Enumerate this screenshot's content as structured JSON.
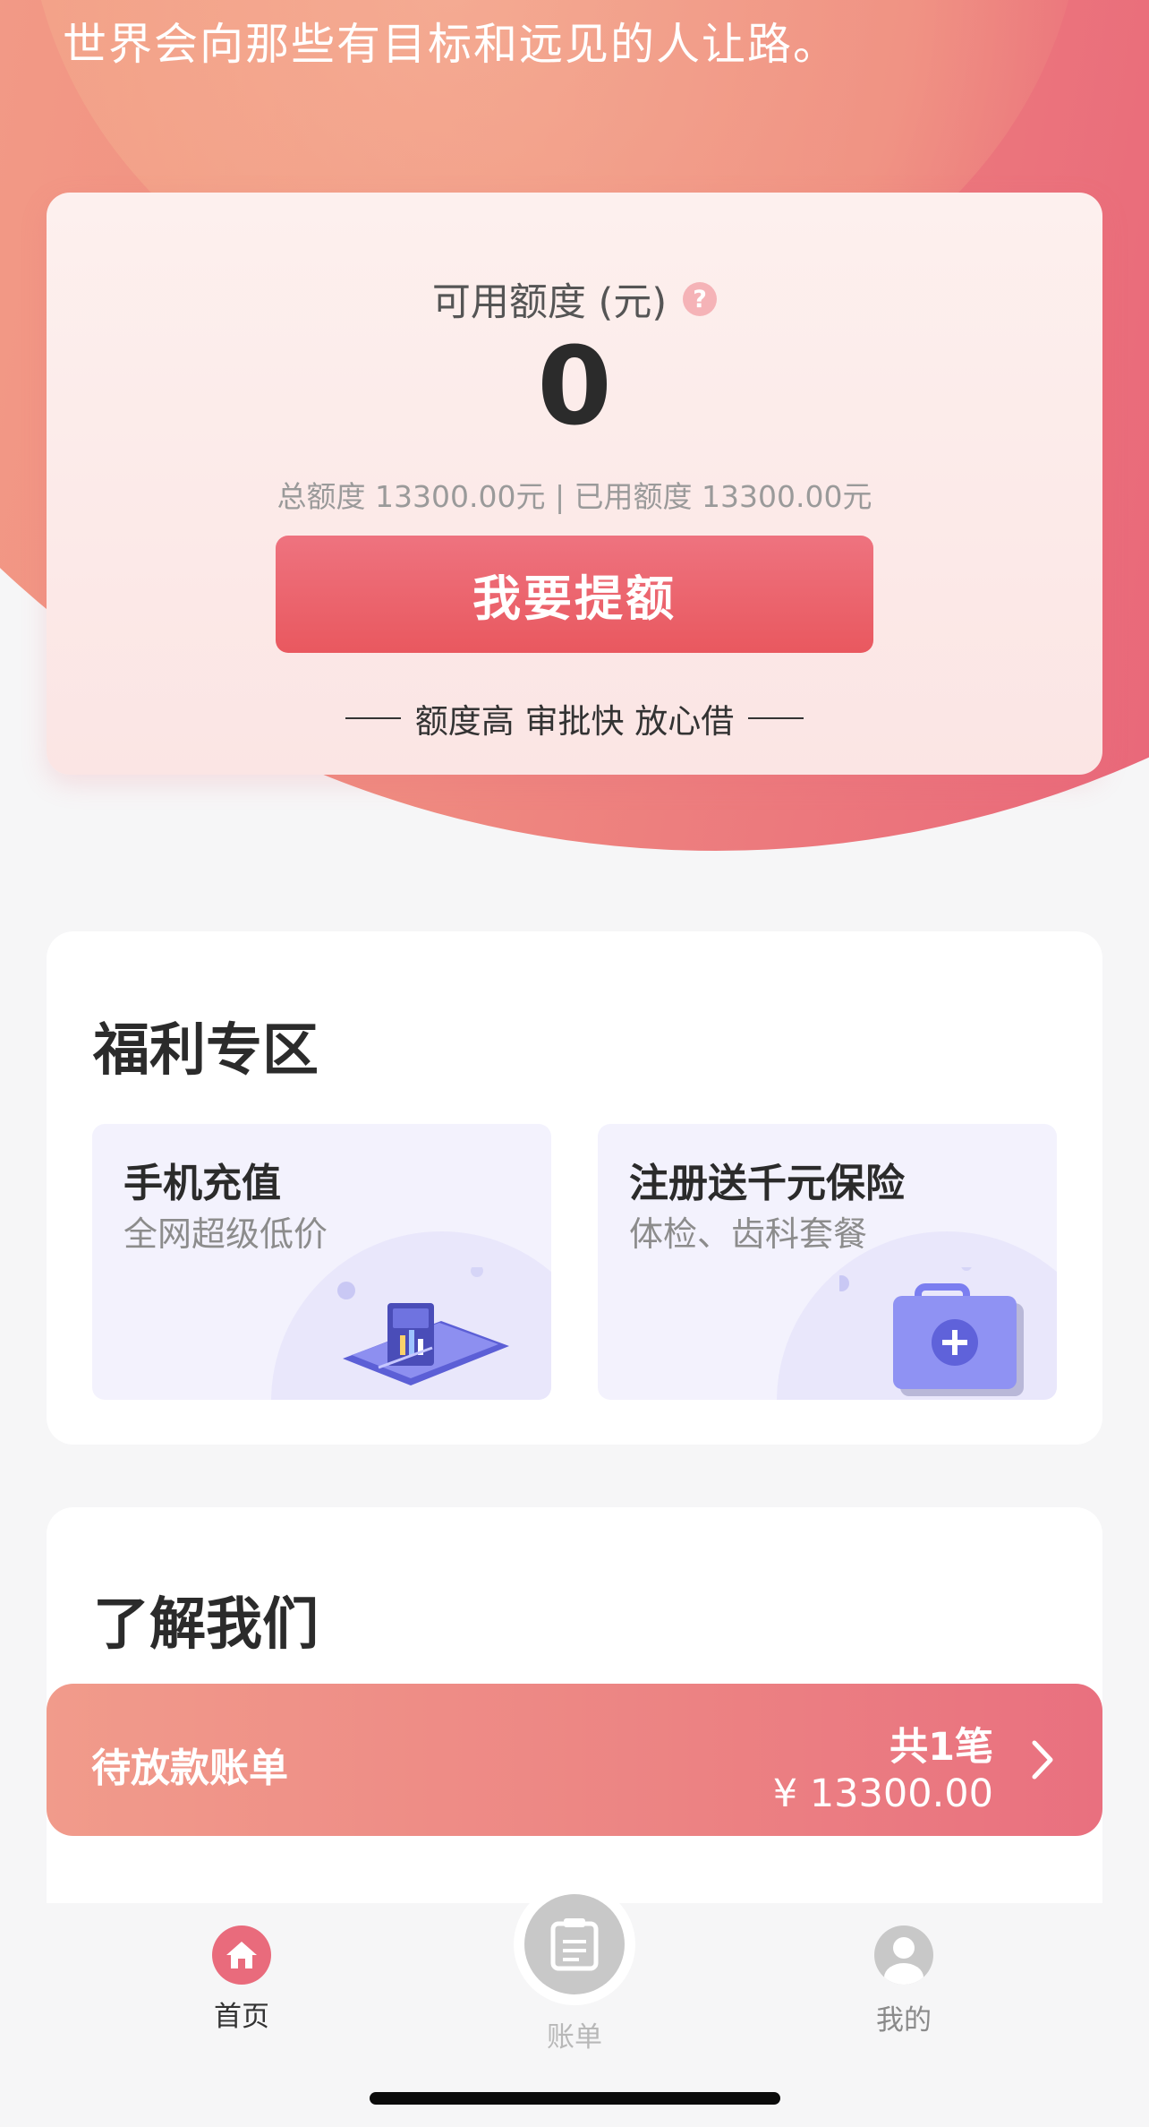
{
  "hero": {
    "slogan": "世界会向那些有目标和远见的人让路。"
  },
  "credit": {
    "label": "可用额度 (元)",
    "help_icon": "?",
    "amount": "0",
    "summary": "总额度 13300.00元 | 已用额度 13300.00元",
    "button_label": "我要提额",
    "tagline": "额度高 审批快 放心借"
  },
  "welfare": {
    "title": "福利专区",
    "tiles": [
      {
        "title": "手机充值",
        "subtitle": "全网超级低价",
        "icon": "phone-card-illustration"
      },
      {
        "title": "注册送千元保险",
        "subtitle": "体检、齿科套餐",
        "icon": "medical-kit-illustration"
      }
    ]
  },
  "about": {
    "title": "了解我们"
  },
  "pending": {
    "label": "待放款账单",
    "count": "共1笔",
    "amount": "¥ 13300.00",
    "icon": "chevron-right-icon"
  },
  "tabbar": {
    "tabs": [
      {
        "label": "首页",
        "icon": "home-icon",
        "active": true
      },
      {
        "label": "账单",
        "icon": "bill-icon",
        "active": false
      },
      {
        "label": "我的",
        "icon": "user-icon",
        "active": false
      }
    ]
  },
  "colors": {
    "accent": "#e9687a",
    "button": "#e9585f",
    "tab_active": "#e96b7c",
    "tab_inactive": "#c8c8c8"
  }
}
